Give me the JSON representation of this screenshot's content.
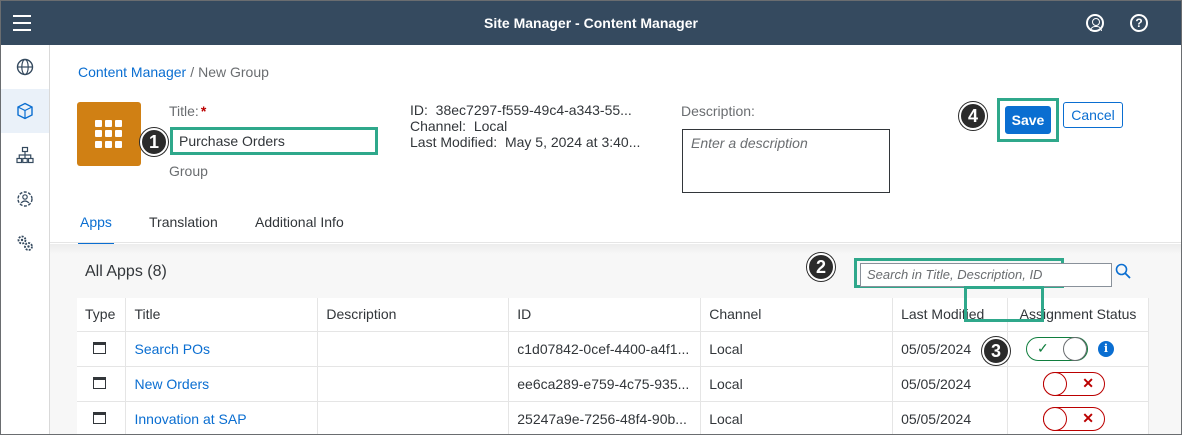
{
  "shell": {
    "title": "Site Manager - Content Manager",
    "menu_icon": "hamburger-icon",
    "user_icon": "user-avatar-icon",
    "help_icon": "help-icon",
    "help_glyph": "?"
  },
  "sidenav": {
    "items": [
      {
        "icon": "globe-icon"
      },
      {
        "icon": "cube-icon",
        "active": true
      },
      {
        "icon": "hierarchy-icon"
      },
      {
        "icon": "role-settings-icon"
      },
      {
        "icon": "gears-icon"
      }
    ]
  },
  "breadcrumb": {
    "link": "Content Manager",
    "separator": "/",
    "current": "New Group"
  },
  "header": {
    "title_label": "Title:",
    "required_mark": "*",
    "title_value": "Purchase Orders",
    "type_label": "Group",
    "id_label": "ID:",
    "id_value": "38ec7297-f559-49c4-a343-55...",
    "channel_label": "Channel:",
    "channel_value": "Local",
    "last_modified_label": "Last Modified:",
    "last_modified_value": "May 5, 2024 at 3:40...",
    "description_label": "Description:",
    "description_placeholder": "Enter a description",
    "save_label": "Save",
    "cancel_label": "Cancel"
  },
  "tabs": [
    {
      "label": "Apps",
      "active": true
    },
    {
      "label": "Translation"
    },
    {
      "label": "Additional Info"
    }
  ],
  "apps": {
    "heading": "All Apps (8)",
    "search_placeholder": "Search in Title, Description, ID",
    "columns": [
      "Type",
      "Title",
      "Description",
      "ID",
      "Channel",
      "Last Modified",
      "Assignment Status"
    ],
    "rows": [
      {
        "title": "Search POs",
        "description": "",
        "id": "c1d07842-0cef-4400-a4f1...",
        "channel": "Local",
        "last_modified": "05/05/2024",
        "assigned": true,
        "check": "✓"
      },
      {
        "title": "New Orders",
        "description": "",
        "id": "ee6ca289-e759-4c75-935...",
        "channel": "Local",
        "last_modified": "05/05/2024",
        "assigned": false,
        "cross": "✕"
      },
      {
        "title": "Innovation at SAP",
        "description": "",
        "id": "25247a9e-7256-48f4-90b...",
        "channel": "Local",
        "last_modified": "05/05/2024",
        "assigned": false,
        "cross": "✕"
      }
    ]
  },
  "callouts": [
    "1",
    "2",
    "3",
    "4"
  ],
  "info_glyph": "i",
  "colors": {
    "shell": "#354a5f",
    "accent": "#0a6ed1",
    "highlight": "#2fa88b",
    "tile": "#d08014",
    "positive": "#107e3e",
    "negative": "#bb0000"
  }
}
